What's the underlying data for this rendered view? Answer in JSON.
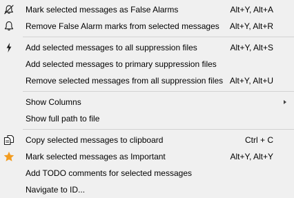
{
  "menu": {
    "groups": [
      [
        {
          "id": "mark-false-alarms",
          "label": "Mark selected messages as False Alarms",
          "shortcut": "Alt+Y, Alt+A",
          "icon": "bell-slash-icon"
        },
        {
          "id": "remove-false-alarm-marks",
          "label": "Remove False Alarm marks from selected messages",
          "shortcut": "Alt+Y, Alt+R",
          "icon": "bell-icon"
        }
      ],
      [
        {
          "id": "add-to-all-suppression",
          "label": "Add selected messages to all suppression files",
          "shortcut": "Alt+Y, Alt+S",
          "icon": "lightning-icon"
        },
        {
          "id": "add-to-primary-suppression",
          "label": "Add selected messages to primary suppression files",
          "shortcut": "",
          "icon": ""
        },
        {
          "id": "remove-from-all-suppression",
          "label": "Remove selected messages from all suppression files",
          "shortcut": "Alt+Y, Alt+U",
          "icon": ""
        }
      ],
      [
        {
          "id": "show-columns",
          "label": "Show Columns",
          "shortcut": "",
          "icon": "",
          "submenu": true
        },
        {
          "id": "show-full-path",
          "label": "Show full path to file",
          "shortcut": "",
          "icon": ""
        }
      ],
      [
        {
          "id": "copy-to-clipboard",
          "label": "Copy selected messages to clipboard",
          "shortcut": "Ctrl + C",
          "icon": "copy-icon"
        },
        {
          "id": "mark-important",
          "label": "Mark selected messages as Important",
          "shortcut": "Alt+Y, Alt+Y",
          "icon": "star-icon"
        },
        {
          "id": "add-todo-comments",
          "label": "Add TODO comments for selected messages",
          "shortcut": "",
          "icon": ""
        },
        {
          "id": "navigate-to-id",
          "label": "Navigate to ID...",
          "shortcut": "",
          "icon": ""
        }
      ]
    ]
  },
  "colors": {
    "background": "#f0f0f0",
    "separator": "#d2d2d2",
    "star": "#f39c1f",
    "icon_stroke": "#1a1a1a"
  }
}
